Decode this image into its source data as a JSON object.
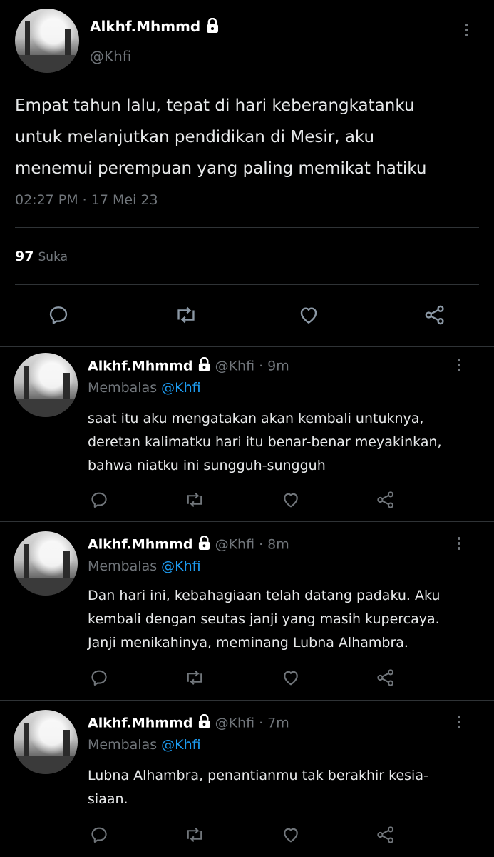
{
  "main": {
    "name": "Alkhf.Mhmmd",
    "handle": "@Khfi",
    "text_lines": [
      "Empat tahun lalu, tepat di hari keberangkatanku",
      "untuk melanjutkan pendidikan di Mesir, aku",
      "menemui perempuan yang paling memikat hatiku"
    ],
    "timestamp": "02:27 PM · 17 Mei 23",
    "likes_count": "97",
    "likes_label": "Suka"
  },
  "replies": [
    {
      "name": "Alkhf.Mhmmd",
      "handle_time": "@Khfi · 9m",
      "replying_prefix": "Membalas",
      "replying_to": "@Khfi",
      "text_lines": [
        "saat itu aku mengatakan akan kembali untuknya,",
        "deretan kalimatku hari itu benar-benar meyakinkan,",
        "bahwa niatku ini sungguh-sungguh"
      ]
    },
    {
      "name": "Alkhf.Mhmmd",
      "handle_time": "@Khfi · 8m",
      "replying_prefix": "Membalas",
      "replying_to": "@Khfi",
      "text_lines": [
        "Dan hari ini, kebahagiaan telah datang padaku. Aku",
        "kembali dengan seutas janji yang masih kupercaya.",
        "Janji menikahinya, meminang Lubna Alhambra."
      ]
    },
    {
      "name": "Alkhf.Mhmmd",
      "handle_time": "@Khfi · 7m",
      "replying_prefix": "Membalas",
      "replying_to": "@Khfi",
      "text_lines": [
        "Lubna Alhambra, penantianmu tak berakhir kesia-",
        "siaan."
      ]
    }
  ],
  "icons": {
    "reply": "reply-icon",
    "retweet": "retweet-icon",
    "like": "like-icon",
    "share": "share-icon",
    "lock": "lock-icon",
    "more": "more-options-icon"
  },
  "colors": {
    "background": "#000000",
    "text": "#e7e9ea",
    "muted": "#71767b",
    "link": "#1d9bf0",
    "divider": "#2f3336"
  }
}
